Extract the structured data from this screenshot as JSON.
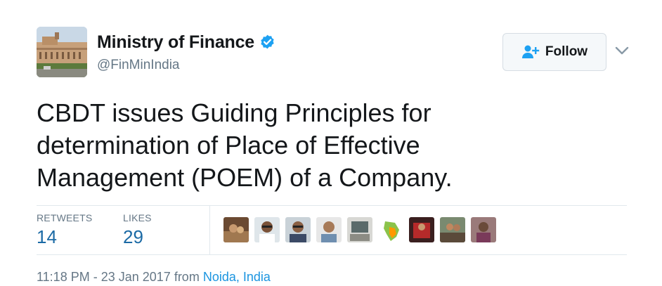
{
  "header": {
    "display_name": "Ministry of Finance",
    "handle": "@FinMinIndia",
    "follow_label": "Follow",
    "verified_icon": "verified-badge-icon",
    "follow_icon": "add-user-icon",
    "more_icon": "chevron-down-icon"
  },
  "tweet": {
    "text": "CBDT issues Guiding Principles for determination of Place of Effective Management (POEM) of a Company."
  },
  "stats": {
    "retweets_label": "RETWEETS",
    "retweets_count": "14",
    "likes_label": "LIKES",
    "likes_count": "29"
  },
  "footer": {
    "timestamp": "11:18 PM - 23 Jan 2017",
    "from_word": "from",
    "location": "Noida, India"
  },
  "colors": {
    "link": "#1b95e0",
    "stat_value": "#1b6aa5",
    "verified": "#1da1f2"
  }
}
